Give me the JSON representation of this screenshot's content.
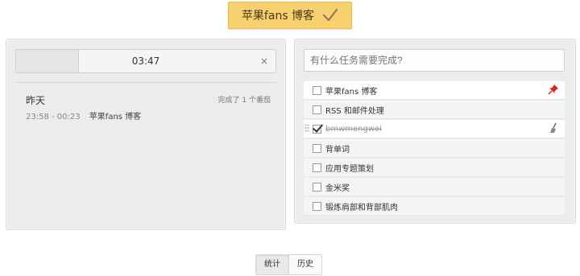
{
  "header": {
    "title": "苹果fans 博客",
    "check_icon": "checkmark-icon"
  },
  "timer": {
    "time": "03:47",
    "close_label": "×",
    "progress": 0.24
  },
  "history": {
    "day_label": "昨天",
    "summary": "完成了 1 个番茄",
    "entries": [
      {
        "time_range": "23:58 - 00:23",
        "title": "苹果fans 博客"
      }
    ]
  },
  "tasks": {
    "input_placeholder": "有什么任务需要完成?",
    "items": [
      {
        "label": "苹果fans 博客",
        "done": false,
        "icon": "pin-icon"
      },
      {
        "label": "RSS 和邮件处理",
        "done": false
      },
      {
        "label": "bmwmengwei",
        "done": true,
        "icon": "broom-icon"
      },
      {
        "label": "背单词",
        "done": false
      },
      {
        "label": "应用专题策划",
        "done": false
      },
      {
        "label": "金米奖",
        "done": false
      },
      {
        "label": "锻炼肩部和背部肌肉",
        "done": false
      }
    ]
  },
  "tabs": [
    {
      "label": "统计",
      "active": true
    },
    {
      "label": "历史",
      "active": false
    }
  ],
  "colors": {
    "accent": "#f8d06f",
    "pin": "#e0261b"
  }
}
